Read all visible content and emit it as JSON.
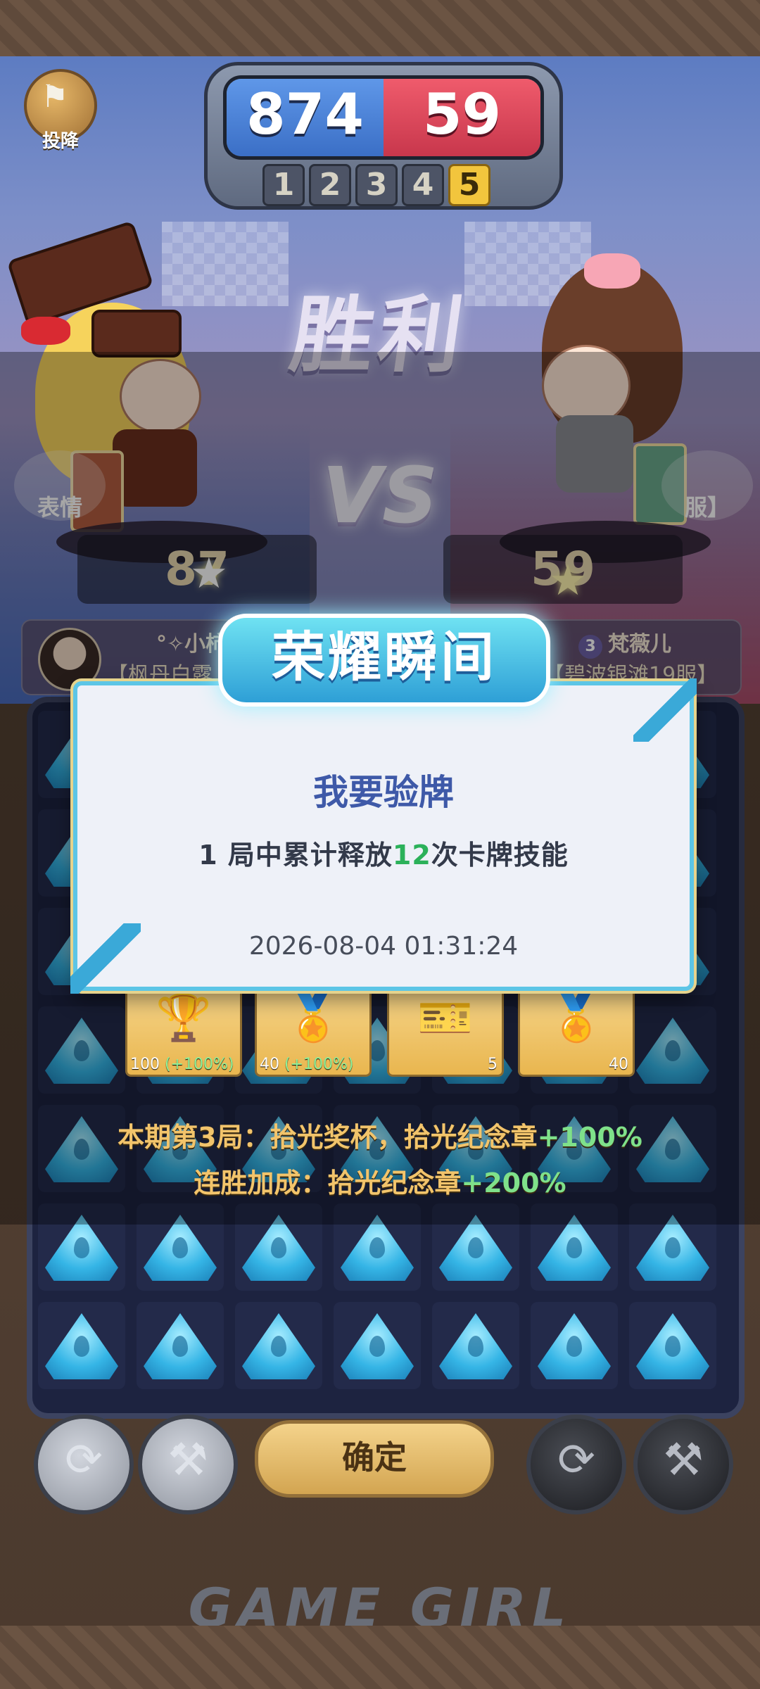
{
  "surrender": {
    "label": "投降"
  },
  "scoreboard": {
    "left_score": "874",
    "right_score": "59",
    "rounds": [
      "1",
      "2",
      "3",
      "4",
      "5"
    ],
    "active_round": "5"
  },
  "victory_text": "胜利",
  "vs_text": "VS",
  "players": {
    "left": {
      "score": "87",
      "name": "°✧小柿",
      "server": "【枫丹白露"
    },
    "right": {
      "score": "59",
      "rank": "3",
      "name": "梵薇儿",
      "server": "【碧波银滩19服】"
    }
  },
  "side_buttons": {
    "left": "表情",
    "right": "服】"
  },
  "popup": {
    "header": "荣耀瞬间",
    "achievement_title": "我要验牌",
    "desc_before": "1 局中累计释放",
    "desc_number": "12",
    "desc_after": "次卡牌技能",
    "time": "2026-08-04 01:31:24"
  },
  "rewards": [
    {
      "icon": "trophy-icon",
      "value": "100",
      "bonus": "(+100%)"
    },
    {
      "icon": "medal-icon",
      "value": "40",
      "bonus": "(+100%)"
    },
    {
      "icon": "ticket-icon",
      "count": "5"
    },
    {
      "icon": "medal-icon",
      "count": "40"
    }
  ],
  "bonus_lines": {
    "line1_prefix": "本期第3局：拾光奖杯，拾光纪念章",
    "line1_value": "+100%",
    "line2_prefix": "连胜加成：拾光纪念章",
    "line2_value": "+200%"
  },
  "controls": {
    "confirm": "确定"
  },
  "brand": "GAME GIRL",
  "colors": {
    "blue_team": "#3b6fc6",
    "red_team": "#c8374c",
    "accent_gold": "#f2c53d",
    "gem": "#35b5e6"
  }
}
